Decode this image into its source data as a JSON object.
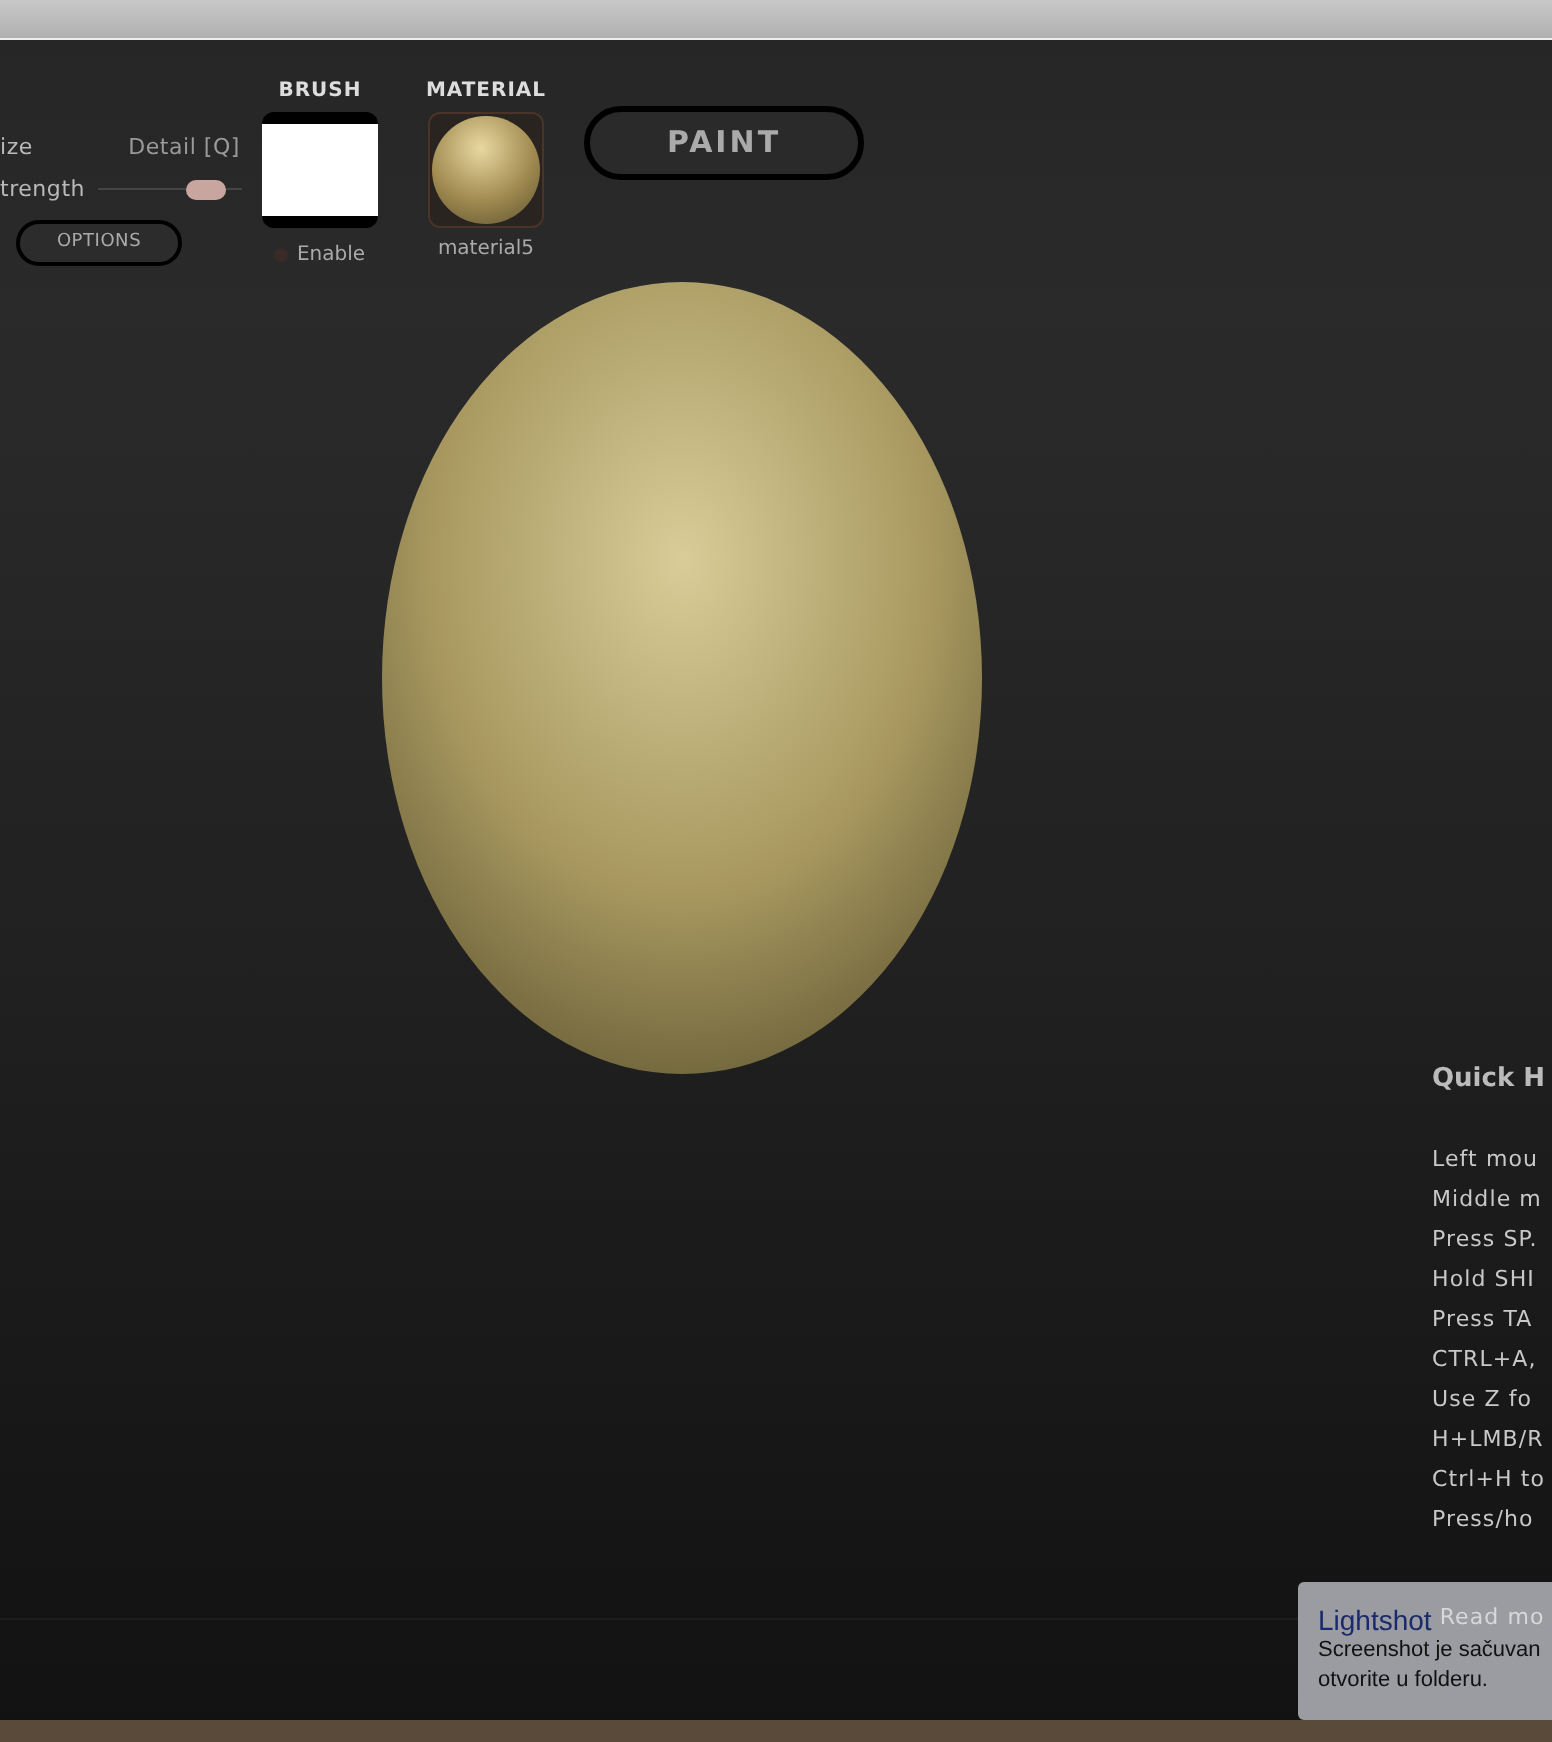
{
  "toolbar": {
    "size_label": "ize",
    "detail_label": "Detail [Q]",
    "strength_label": "trength",
    "strength_slider": {
      "level": 0.9
    },
    "options_button": "OPTIONS",
    "brush": {
      "label": "BRUSH",
      "enable": {
        "label": "Enable",
        "on": false
      }
    },
    "material": {
      "label": "MATERIAL",
      "name": "material5"
    },
    "paint_button": "PAINT"
  },
  "quick_help": {
    "title": "Quick H",
    "lines": [
      "Left mou",
      "Middle m",
      "Press SP.",
      "Hold SHI",
      "Press TA",
      "CTRL+A,",
      "Use Z fo",
      "H+LMB/R",
      "Ctrl+H to",
      "Press/ho"
    ],
    "read_more": "Read mo"
  },
  "notification": {
    "title": "Lightshot",
    "lines": [
      "Screenshot je sačuvan",
      "otvorite u folderu."
    ]
  }
}
